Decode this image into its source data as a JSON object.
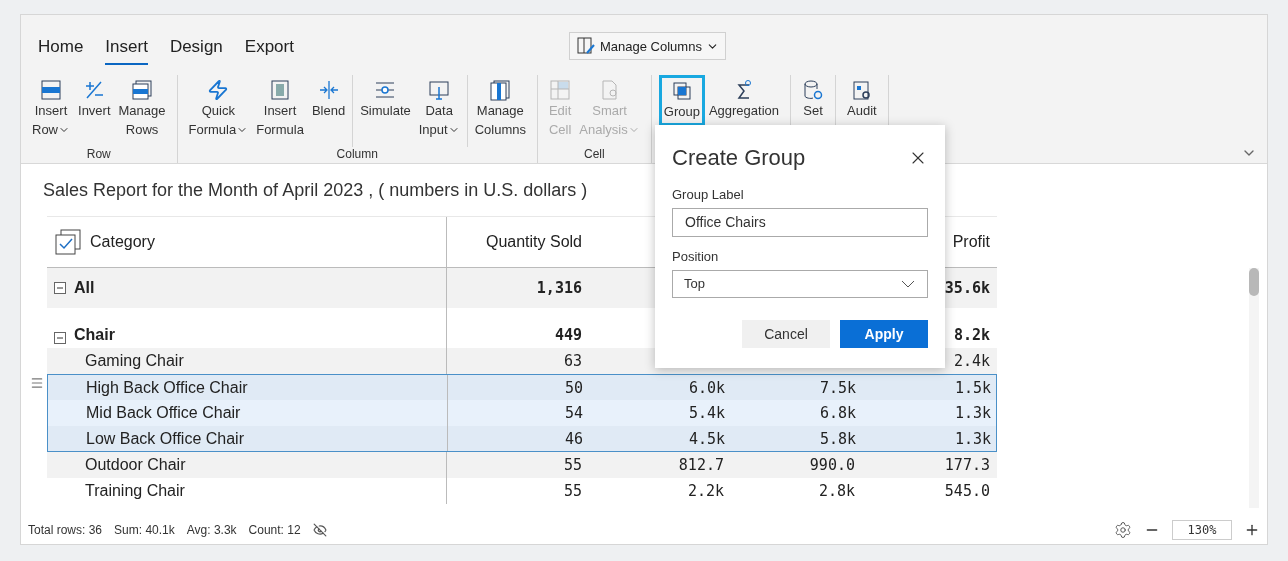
{
  "ribbon": {
    "tabs": [
      {
        "label": "Home",
        "selected": false
      },
      {
        "label": "Insert",
        "selected": true
      },
      {
        "label": "Design",
        "selected": false
      },
      {
        "label": "Export",
        "selected": false
      }
    ],
    "quick_button": {
      "label": "Manage Columns"
    },
    "groups": [
      {
        "label": "Row",
        "sections": [
          [
            {
              "kind": "insert-row",
              "lines": [
                "Insert",
                "Row"
              ],
              "dropdown": true,
              "disabled": false,
              "selected": false
            },
            {
              "kind": "invert",
              "lines": [
                "Invert"
              ],
              "dropdown": false,
              "disabled": false,
              "selected": false
            },
            {
              "kind": "manage-rows",
              "lines": [
                "Manage",
                "Rows"
              ],
              "dropdown": false,
              "disabled": false,
              "selected": false
            }
          ]
        ]
      },
      {
        "label": "Column",
        "sections": [
          [
            {
              "kind": "quick-formula",
              "lines": [
                "Quick",
                "Formula"
              ],
              "dropdown": true,
              "disabled": false,
              "selected": false
            },
            {
              "kind": "insert-formula",
              "lines": [
                "Insert",
                "Formula"
              ],
              "dropdown": false,
              "disabled": false,
              "selected": false
            },
            {
              "kind": "blend",
              "lines": [
                "Blend"
              ],
              "dropdown": false,
              "disabled": false,
              "selected": false
            }
          ],
          [
            {
              "kind": "simulate",
              "lines": [
                "Simulate"
              ],
              "dropdown": false,
              "disabled": false,
              "selected": false
            },
            {
              "kind": "data-input",
              "lines": [
                "Data",
                "Input"
              ],
              "dropdown": true,
              "disabled": false,
              "selected": false
            }
          ],
          [
            {
              "kind": "manage-columns",
              "lines": [
                "Manage",
                "Columns"
              ],
              "dropdown": false,
              "disabled": false,
              "selected": false
            }
          ]
        ]
      },
      {
        "label": "Cell",
        "sections": [
          [
            {
              "kind": "edit-cell",
              "lines": [
                "Edit",
                "Cell"
              ],
              "dropdown": false,
              "disabled": true,
              "selected": false
            },
            {
              "kind": "smart-analysis",
              "lines": [
                "Smart",
                "Analysis"
              ],
              "dropdown": true,
              "disabled": true,
              "selected": false
            }
          ]
        ]
      },
      {
        "sections": [
          [
            {
              "kind": "group",
              "lines": [
                "Group"
              ],
              "dropdown": false,
              "disabled": false,
              "selected": true
            },
            {
              "kind": "aggregation",
              "lines": [
                "Aggregation"
              ],
              "dropdown": false,
              "disabled": false,
              "selected": false
            }
          ]
        ]
      },
      {
        "sections": [
          [
            {
              "kind": "set",
              "lines": [
                "Set"
              ],
              "dropdown": false,
              "disabled": false,
              "selected": false
            }
          ]
        ]
      },
      {
        "sections": [
          [
            {
              "kind": "audit",
              "lines": [
                "Audit"
              ],
              "dropdown": false,
              "disabled": false,
              "selected": false
            }
          ]
        ]
      }
    ]
  },
  "report_title": "Sales Report for the Month of April 2023 , ( numbers in U.S. dollars )",
  "table": {
    "columns": {
      "category": "Category",
      "quantity_sold": "Quantity Sold",
      "profit": "Profit"
    },
    "rows": [
      {
        "kind": "total",
        "category": "All",
        "expanded": true,
        "selected": false,
        "quantity_sold": "1,316",
        "profit": "35.6k"
      },
      {
        "kind": "group",
        "category": "Chair",
        "expanded": true,
        "selected": false,
        "quantity_sold": "449",
        "profit": "8.2k"
      },
      {
        "kind": "item",
        "category": "Gaming Chair",
        "selected": false,
        "quantity_sold": "63",
        "profit": "2.4k"
      },
      {
        "kind": "item",
        "category": "High Back Office Chair",
        "selected": true,
        "quantity_sold": "50",
        "column_3": "6.0k",
        "column_4": "7.5k",
        "profit": "1.5k"
      },
      {
        "kind": "item",
        "category": "Mid Back Office Chair",
        "selected": true,
        "quantity_sold": "54",
        "column_3": "5.4k",
        "column_4": "6.8k",
        "profit": "1.3k"
      },
      {
        "kind": "item",
        "category": "Low Back Office Chair",
        "selected": true,
        "quantity_sold": "46",
        "column_3": "4.5k",
        "column_4": "5.8k",
        "profit": "1.3k"
      },
      {
        "kind": "item",
        "category": "Outdoor Chair",
        "selected": false,
        "quantity_sold": "55",
        "column_3": "812.7",
        "column_4": "990.0",
        "profit": "177.3"
      },
      {
        "kind": "item",
        "category": "Training Chair",
        "selected": false,
        "quantity_sold": "55",
        "column_3": "2.2k",
        "column_4": "2.8k",
        "profit": "545.0"
      }
    ]
  },
  "dialog": {
    "title": "Create Group",
    "fields": [
      {
        "kind": "text",
        "label": "Group Label",
        "value": "Office Chairs"
      },
      {
        "kind": "select",
        "label": "Position",
        "value": "Top"
      }
    ],
    "buttons": [
      {
        "label": "Cancel",
        "primary": false
      },
      {
        "label": "Apply",
        "primary": true
      }
    ]
  },
  "status_bar": {
    "stats": [
      "Total rows: 36",
      "Sum: 40.1k",
      "Avg: 3.3k",
      "Count: 12"
    ],
    "zoom": "130%"
  }
}
